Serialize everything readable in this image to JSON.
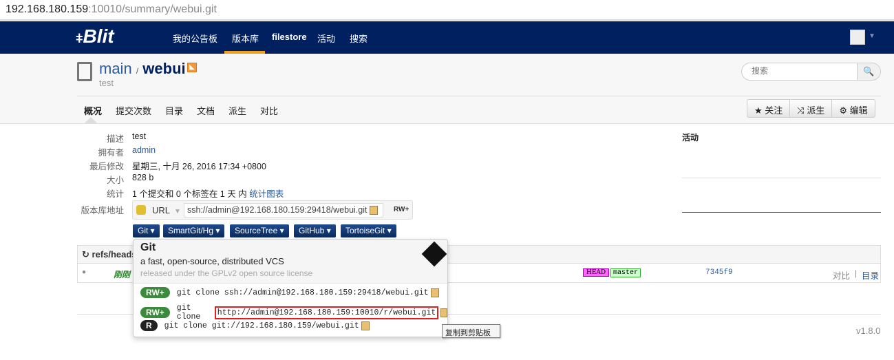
{
  "address_bar": {
    "host": "192.168.180.159",
    "rest": ":10010/summary/webui.git"
  },
  "nav": {
    "logo": "Blit",
    "items": [
      "我的公告板",
      "版本库",
      "filestore",
      "活动",
      "搜索"
    ],
    "active_index": 1,
    "accent": "#f0a020",
    "bg": "#002060"
  },
  "repo": {
    "project": "main",
    "sep": "/",
    "name": "webui",
    "description": "test"
  },
  "search": {
    "placeholder": "搜索"
  },
  "tabs": [
    "概况",
    "提交次数",
    "目录",
    "文档",
    "派生",
    "对比"
  ],
  "actions": {
    "watch": "关注",
    "fork": "派生",
    "edit": "编辑"
  },
  "summary": {
    "labels": {
      "desc": "描述",
      "owner": "拥有者",
      "modified": "最后修改",
      "size": "大小",
      "stats": "统计",
      "url": "版本库地址"
    },
    "desc": "test",
    "owner": "admin",
    "modified": "星期三, 十月 26, 2016 17:34 +0800",
    "size": "828 b",
    "stats": "1 个提交和 0 个标签在 1 天 内",
    "stats_link": "统计图表",
    "url_type": "URL",
    "url": "ssh://admin@192.168.180.159:29418/webui.git",
    "url_perm": "RW+"
  },
  "tools": [
    "Git",
    "SmartGit/Hg",
    "SourceTree",
    "GitHub",
    "TortoiseGit"
  ],
  "activity": {
    "title": "活动"
  },
  "refs": {
    "header": "refs/heads",
    "row": {
      "name": "刚刚",
      "head": "HEAD",
      "branch": "master",
      "commit": "7345f9",
      "compare": "对比",
      "sep": "|",
      "tree": "目录"
    }
  },
  "popover": {
    "title": "Git",
    "desc": "a fast, open-source, distributed VCS",
    "license": "released under the GPLv2 open source license",
    "clones": [
      {
        "perm": "RW+",
        "cmd": "git clone",
        "url": "ssh://admin@192.168.180.159:29418/webui.git"
      },
      {
        "perm": "RW+",
        "cmd": "git clone",
        "url": "http://admin@192.168.180.159:10010/r/webui.git"
      },
      {
        "perm": "R",
        "cmd": "git clone",
        "url": "git://192.168.180.159/webui.git"
      }
    ]
  },
  "tooltip": "复制到剪贴板",
  "footer": {
    "version": "v1.8.0"
  }
}
